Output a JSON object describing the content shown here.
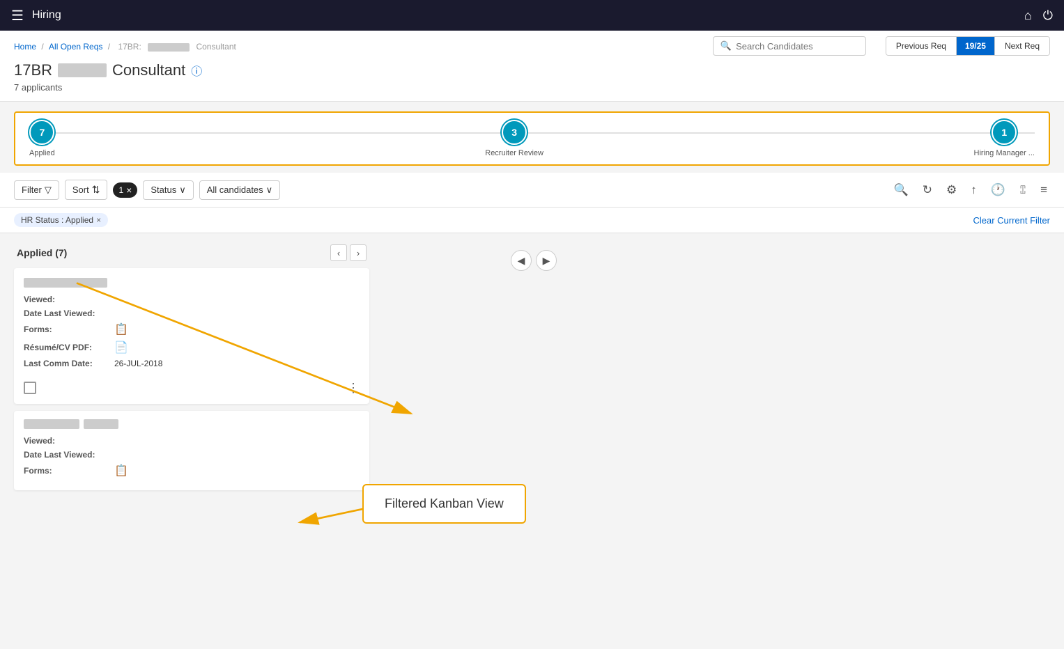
{
  "topNav": {
    "title": "Hiring",
    "homeIcon": "⌂",
    "powerIcon": "⏻"
  },
  "breadcrumb": {
    "home": "Home",
    "separator1": "/",
    "allOpenReqs": "All Open Reqs",
    "separator2": "/",
    "reqId": "17BR:",
    "reqName": "Consultant"
  },
  "pageTitle": {
    "reqId": "17BR",
    "blurredPart": "████ ███",
    "role": "Consultant",
    "applicantCount": "7 applicants"
  },
  "header": {
    "searchPlaceholder": "Search Candidates",
    "prevReq": "Previous Req",
    "navCount": "19/25",
    "nextReq": "Next Req"
  },
  "pipeline": {
    "stages": [
      {
        "id": "applied",
        "count": "7",
        "label": "Applied"
      },
      {
        "id": "recruiter-review",
        "count": "3",
        "label": "Recruiter Review"
      },
      {
        "id": "hiring-manager",
        "count": "1",
        "label": "Hiring Manager ..."
      }
    ]
  },
  "toolbar": {
    "filterLabel": "Filter",
    "sortLabel": "Sort",
    "activeFilterCount": "1",
    "activeFilterClose": "×",
    "statusLabel": "Status",
    "allCandidatesLabel": "All candidates",
    "clearFilterLink": "Clear Current Filter"
  },
  "filterTags": [
    {
      "label": "HR Status : Applied",
      "close": "×"
    }
  ],
  "kanbanNav": {
    "prevArrow": "◀",
    "nextArrow": "▶"
  },
  "appliedColumn": {
    "title": "Applied (7)",
    "prevBtn": "‹",
    "nextBtn": "›"
  },
  "candidates": [
    {
      "nameBlurred": true,
      "nameWidth": "120px",
      "viewed": "",
      "dateLastViewed": "",
      "formsIcon": "📋",
      "resumeIcon": "📄",
      "lastCommDate": "26-JUL-2018",
      "fields": [
        {
          "label": "Viewed:",
          "value": ""
        },
        {
          "label": "Date Last Viewed:",
          "value": ""
        },
        {
          "label": "Forms:",
          "value": "",
          "icon": "forms"
        },
        {
          "label": "Résumé/CV PDF:",
          "value": "",
          "icon": "resume"
        },
        {
          "label": "Last Comm Date:",
          "value": "26-JUL-2018"
        }
      ]
    },
    {
      "nameBlurred": true,
      "nameWidth": "100px",
      "fields": [
        {
          "label": "Viewed:",
          "value": ""
        },
        {
          "label": "Date Last Viewed:",
          "value": ""
        },
        {
          "label": "Forms:",
          "value": "",
          "icon": "forms"
        }
      ]
    }
  ],
  "annotationBox": {
    "text": "Filtered Kanban View"
  },
  "colors": {
    "topNavBg": "#1a1a2e",
    "accent": "#0099bb",
    "orange": "#f0a500",
    "linkBlue": "#0066cc"
  }
}
